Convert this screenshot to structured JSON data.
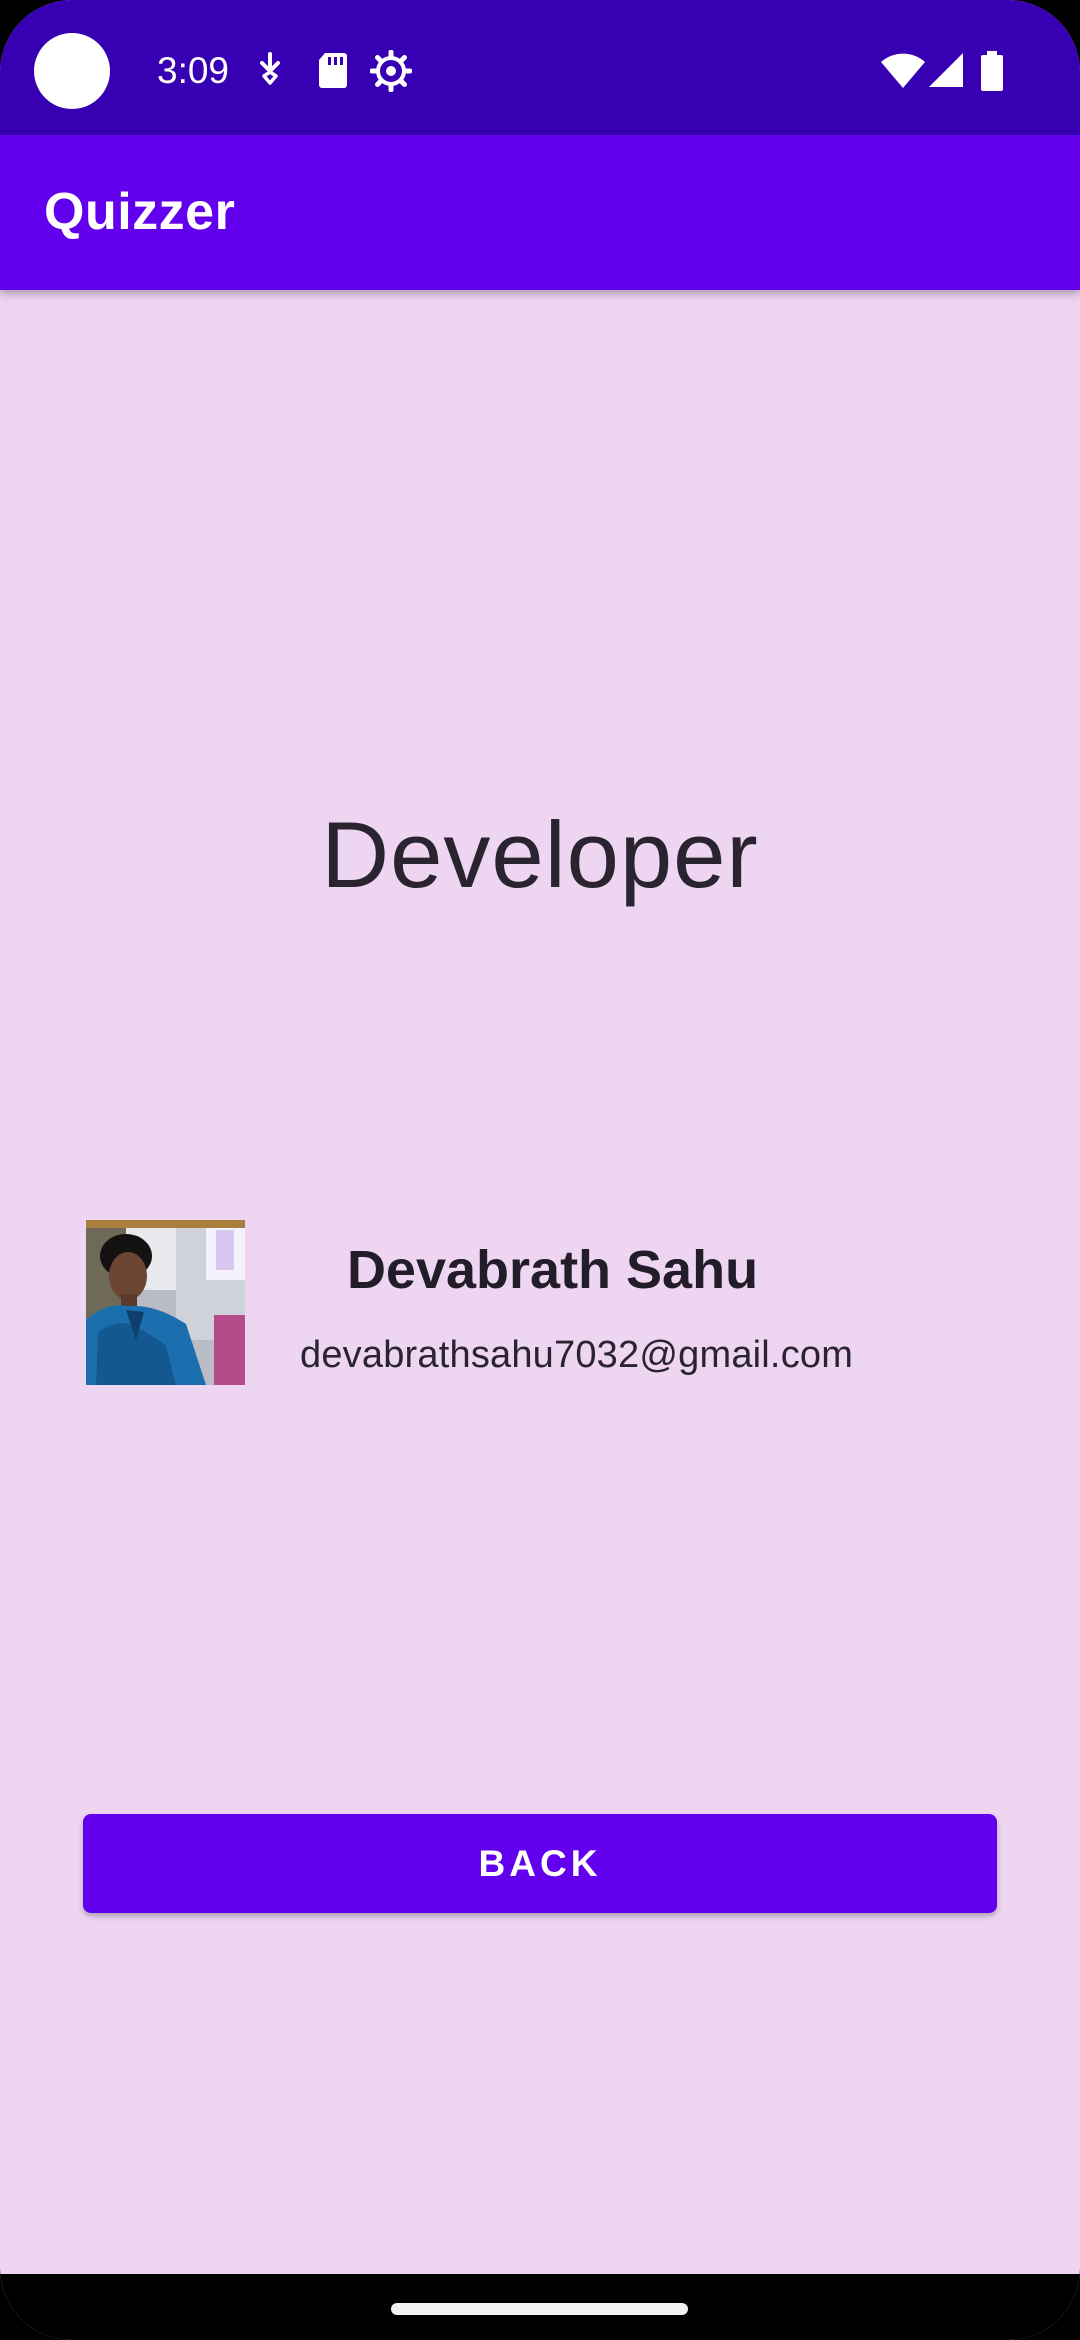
{
  "status_bar": {
    "time": "3:09",
    "left_icons": [
      "camera-cutout",
      "download-icon",
      "sd-card-icon",
      "settings-gear-icon"
    ],
    "right_icons": [
      "wifi-icon",
      "signal-icon",
      "battery-icon"
    ],
    "color": "#3700b3"
  },
  "app_bar": {
    "title": "Quizzer",
    "color": "#6200ee"
  },
  "main": {
    "heading": "Developer",
    "developer": {
      "name": "Devabrath Sahu",
      "email": "devabrathsahu7032@gmail.com",
      "photo": "developer-avatar"
    },
    "back_button_label": "BACK",
    "background": "#eed6f2"
  }
}
